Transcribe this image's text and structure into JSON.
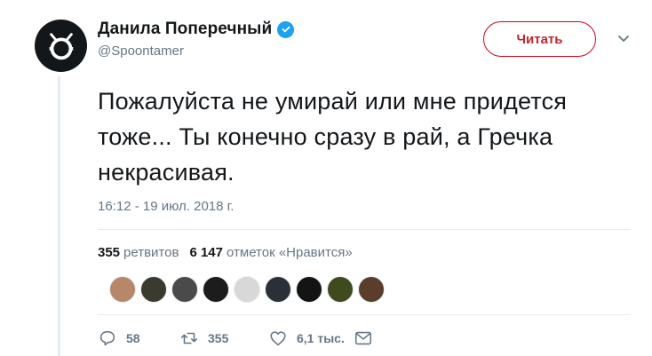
{
  "author": {
    "name": "Данила Поперечный",
    "handle": "@Spoontamer"
  },
  "follow_label": "Читать",
  "tweet": {
    "text": "Пожалуйста не умирай или мне придется тоже... Ты конечно сразу в рай, а Гречка некрасивая.",
    "timestamp": "16:12 - 19 июл. 2018 г."
  },
  "stats": {
    "retweets_count": "355",
    "retweets_label": "ретвитов",
    "likes_count": "6 147",
    "likes_label": "отметок «Нравится»"
  },
  "likers": [
    {
      "color": "#b8876a"
    },
    {
      "color": "#3a3a2e"
    },
    {
      "color": "#4a4a4a"
    },
    {
      "color": "#1c1c1c"
    },
    {
      "color": "#d8d8d8"
    },
    {
      "color": "#2b2f38"
    },
    {
      "color": "#141414"
    },
    {
      "color": "#3f4a1e"
    },
    {
      "color": "#5a3d2b"
    }
  ],
  "actions": {
    "replies": "58",
    "retweets": "355",
    "likes": "6,1 тыс."
  },
  "colors": {
    "accent": "#1da1f2",
    "follow_border": "#d0021b",
    "muted": "#657786"
  }
}
